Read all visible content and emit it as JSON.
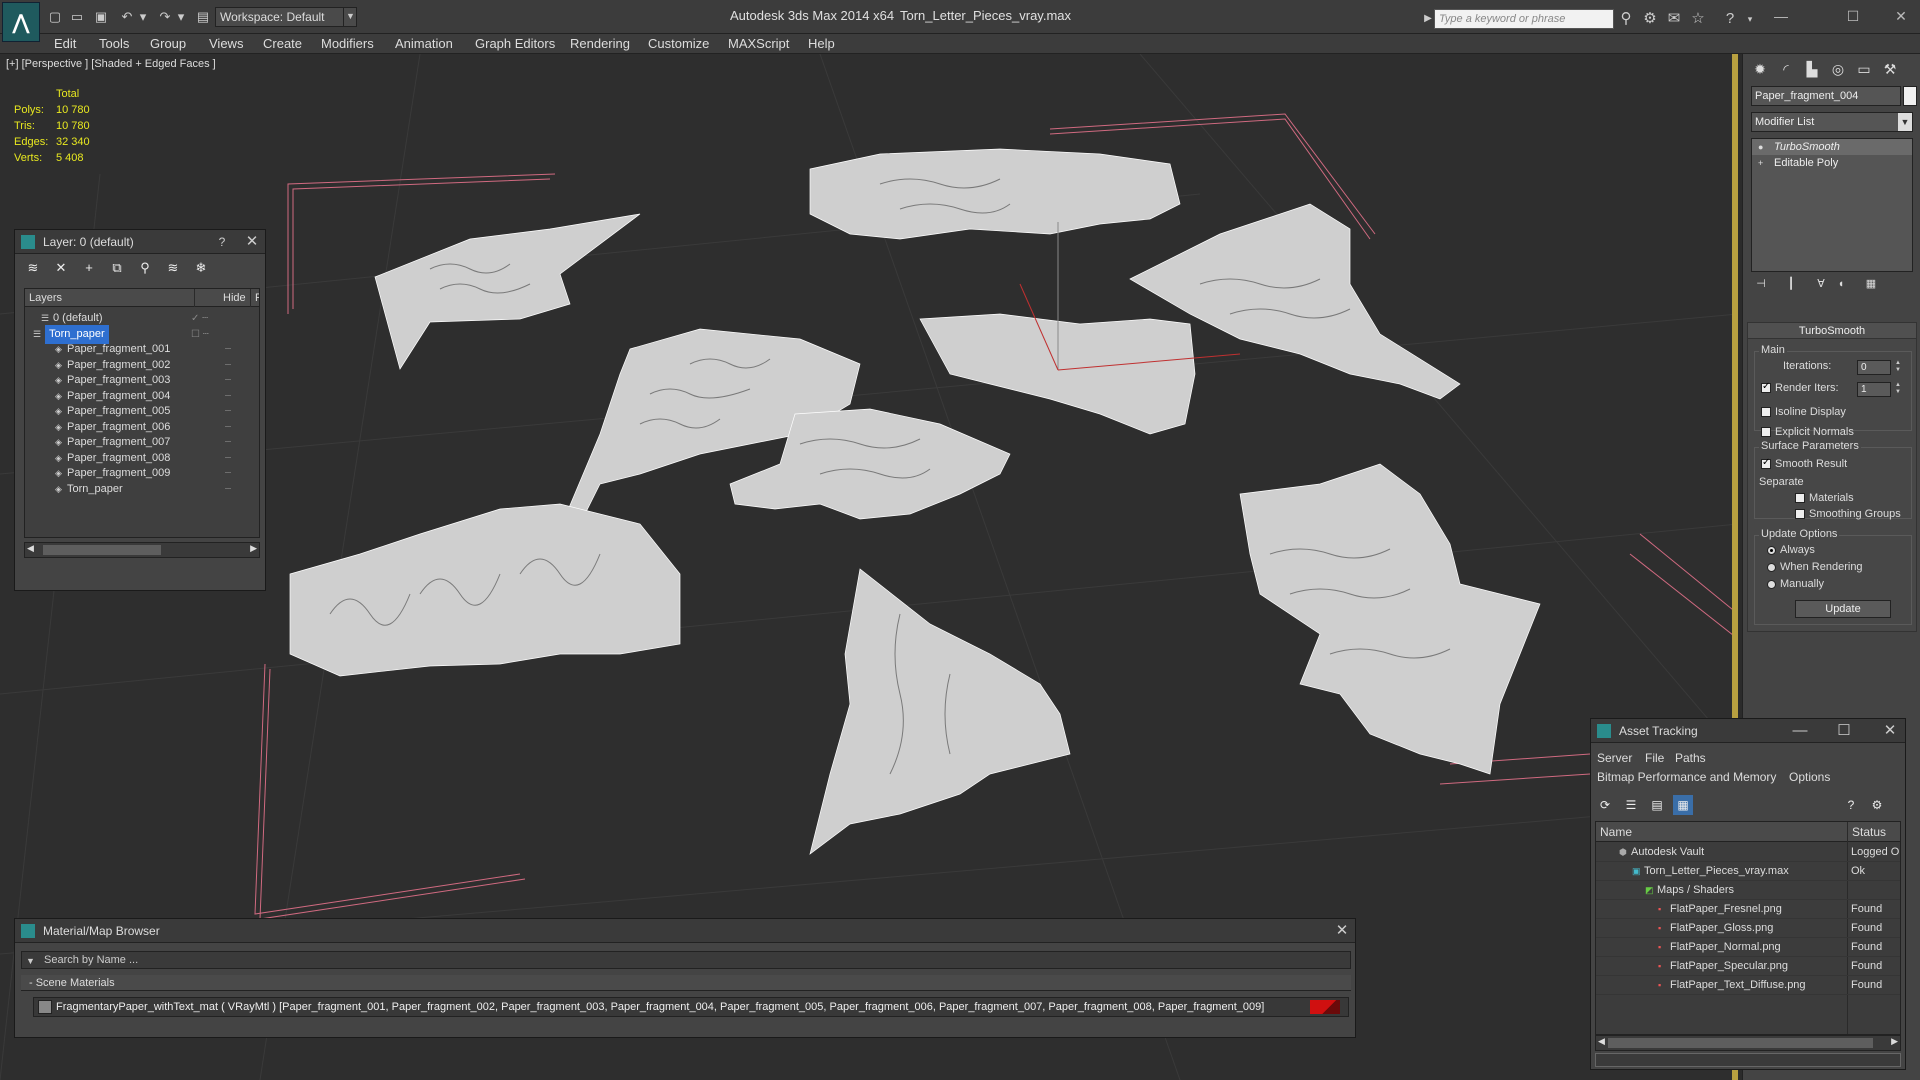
{
  "titlebar": {
    "workspace": "Workspace: Default",
    "app_title": "Autodesk 3ds Max  2014 x64",
    "file_title": "Torn_Letter_Pieces_vray.max",
    "search_placeholder": "Type a keyword or phrase"
  },
  "menu": [
    "Edit",
    "Tools",
    "Group",
    "Views",
    "Create",
    "Modifiers",
    "Animation",
    "Graph Editors",
    "Rendering",
    "Customize",
    "MAXScript",
    "Help"
  ],
  "viewport": {
    "label": "[+] [Perspective ] [Shaded + Edged Faces ]",
    "stats": {
      "header": "Total",
      "polys_label": "Polys:",
      "polys": "10 780",
      "tris_label": "Tris:",
      "tris": "10 780",
      "edges_label": "Edges:",
      "edges": "32 340",
      "verts_label": "Verts:",
      "verts": "5 408"
    }
  },
  "command_panel": {
    "object_name": "Paper_fragment_004",
    "modifier_list": "Modifier List",
    "stack": [
      "TurboSmooth",
      "Editable Poly"
    ],
    "rollout_title": "TurboSmooth",
    "main_group": "Main",
    "iterations_label": "Iterations:",
    "iterations": "0",
    "render_iters_label": "Render Iters:",
    "render_iters": "1",
    "isoline": "Isoline Display",
    "explicit_normals": "Explicit Normals",
    "surface_group": "Surface Parameters",
    "smooth_result": "Smooth Result",
    "separate": "Separate",
    "materials": "Materials",
    "smoothing_groups": "Smoothing Groups",
    "update_group": "Update Options",
    "always": "Always",
    "when_rendering": "When Rendering",
    "manually": "Manually",
    "update_button": "Update"
  },
  "layer_panel": {
    "title": "Layer: 0 (default)",
    "help": "?",
    "col_layers": "Layers",
    "col_hide": "Hide",
    "col_f": "F",
    "rows": [
      {
        "name": "0 (default)",
        "level": 1
      },
      {
        "name": "Torn_paper",
        "level": 0
      },
      {
        "name": "Paper_fragment_001",
        "level": 2
      },
      {
        "name": "Paper_fragment_002",
        "level": 2
      },
      {
        "name": "Paper_fragment_003",
        "level": 2
      },
      {
        "name": "Paper_fragment_004",
        "level": 2
      },
      {
        "name": "Paper_fragment_005",
        "level": 2
      },
      {
        "name": "Paper_fragment_006",
        "level": 2
      },
      {
        "name": "Paper_fragment_007",
        "level": 2
      },
      {
        "name": "Paper_fragment_008",
        "level": 2
      },
      {
        "name": "Paper_fragment_009",
        "level": 2
      },
      {
        "name": "Torn_paper",
        "level": 2
      }
    ]
  },
  "material_browser": {
    "title": "Material/Map Browser",
    "search_placeholder": "Search by Name ...",
    "group": "- Scene Materials",
    "material": "FragmentaryPaper_withText_mat  ( VRayMtl )  [Paper_fragment_001, Paper_fragment_002, Paper_fragment_003, Paper_fragment_004, Paper_fragment_005, Paper_fragment_006, Paper_fragment_007, Paper_fragment_008, Paper_fragment_009]"
  },
  "asset_tracking": {
    "title": "Asset Tracking",
    "menu_server": "Server",
    "menu_file": "File",
    "menu_paths": "Paths",
    "menu_bitmap": "Bitmap Performance and Memory",
    "menu_options": "Options",
    "col_name": "Name",
    "col_status": "Status",
    "rows": [
      {
        "name": "Autodesk Vault",
        "status": "Logged O",
        "indent": 1,
        "icon": "vault-icon"
      },
      {
        "name": "Torn_Letter_Pieces_vray.max",
        "status": "Ok",
        "indent": 2,
        "icon": "max-file-icon"
      },
      {
        "name": "Maps / Shaders",
        "status": "",
        "indent": 3,
        "icon": "maps-icon"
      },
      {
        "name": "FlatPaper_Fresnel.png",
        "status": "Found",
        "indent": 4,
        "icon": "png-icon"
      },
      {
        "name": "FlatPaper_Gloss.png",
        "status": "Found",
        "indent": 4,
        "icon": "png-icon"
      },
      {
        "name": "FlatPaper_Normal.png",
        "status": "Found",
        "indent": 4,
        "icon": "png-icon"
      },
      {
        "name": "FlatPaper_Specular.png",
        "status": "Found",
        "indent": 4,
        "icon": "png-icon"
      },
      {
        "name": "FlatPaper_Text_Diffuse.png",
        "status": "Found",
        "indent": 4,
        "icon": "png-icon"
      }
    ]
  }
}
